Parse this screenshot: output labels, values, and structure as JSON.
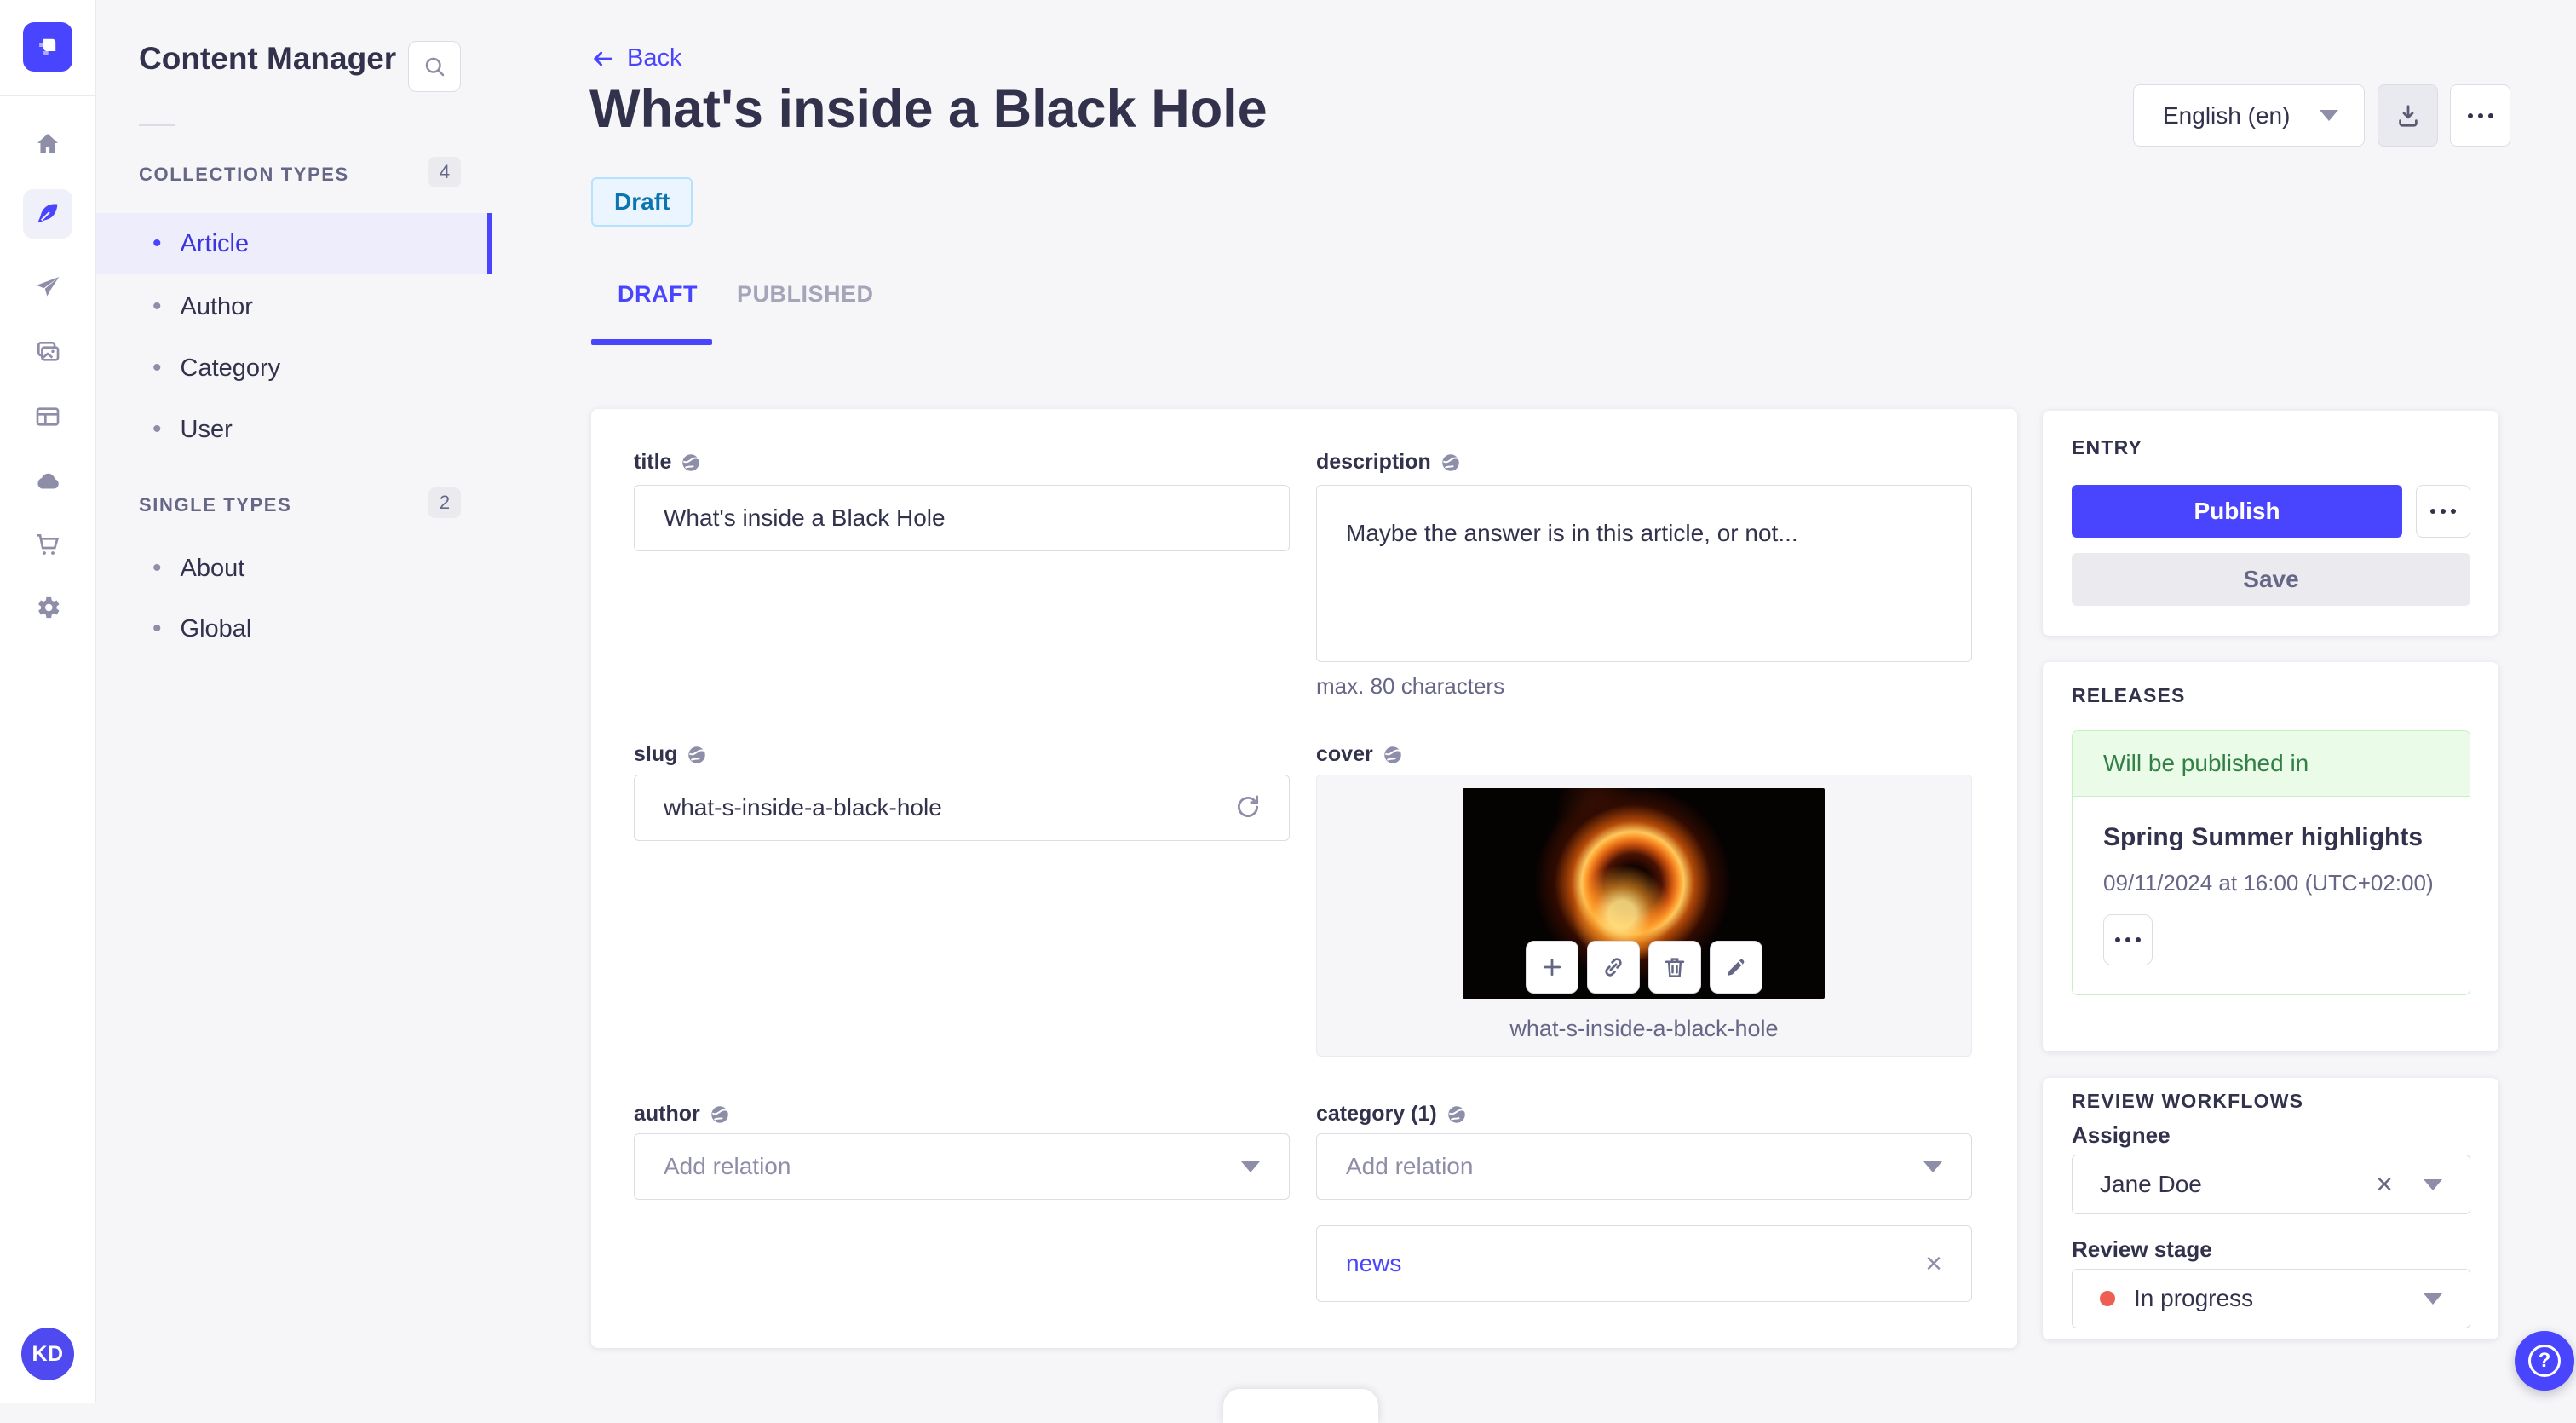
{
  "app": {
    "user_initials": "KD"
  },
  "sidebar": {
    "title": "Content Manager",
    "sections": [
      {
        "label": "COLLECTION TYPES",
        "badge": "4",
        "items": [
          {
            "label": "Article"
          },
          {
            "label": "Author"
          },
          {
            "label": "Category"
          },
          {
            "label": "User"
          }
        ]
      },
      {
        "label": "SINGLE TYPES",
        "badge": "2",
        "items": [
          {
            "label": "About"
          },
          {
            "label": "Global"
          }
        ]
      }
    ]
  },
  "header": {
    "back_label": "Back",
    "title": "What's inside a Black Hole",
    "status_badge": "Draft",
    "language": "English (en)",
    "tabs": [
      {
        "label": "DRAFT"
      },
      {
        "label": "PUBLISHED"
      }
    ]
  },
  "form": {
    "title": {
      "label": "title",
      "value": "What's inside a Black Hole"
    },
    "description": {
      "label": "description",
      "value": "Maybe the answer is in this article, or not...",
      "helper": "max. 80 characters"
    },
    "slug": {
      "label": "slug",
      "value": "what-s-inside-a-black-hole"
    },
    "cover": {
      "label": "cover",
      "caption": "what-s-inside-a-black-hole"
    },
    "author": {
      "label": "author",
      "placeholder": "Add relation"
    },
    "category": {
      "label": "category (1)",
      "placeholder": "Add relation",
      "relation": "news"
    }
  },
  "entry_panel": {
    "title": "ENTRY",
    "publish_label": "Publish",
    "save_label": "Save"
  },
  "releases_panel": {
    "title": "RELEASES",
    "status": "Will be published in",
    "release_name": "Spring Summer highlights",
    "release_date": "09/11/2024 at 16:00 (UTC+02:00)"
  },
  "review_panel": {
    "title": "REVIEW WORKFLOWS",
    "assignee_label": "Assignee",
    "assignee_value": "Jane Doe",
    "stage_label": "Review stage",
    "stage_value": "In progress"
  },
  "colors": {
    "primary": "#4945ff",
    "draft_text": "#0c75af",
    "success": "#328048",
    "stage_dot": "#ee5e52"
  }
}
